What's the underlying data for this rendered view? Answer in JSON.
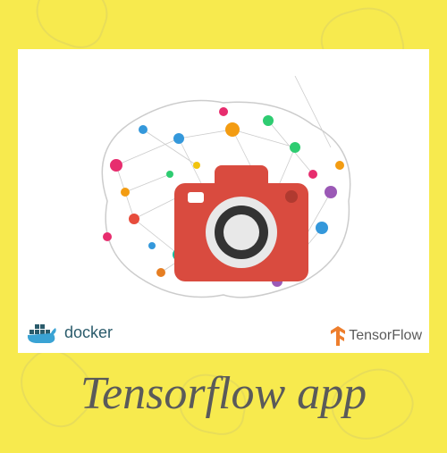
{
  "title": "Tensorflow app",
  "logos": {
    "docker": {
      "text": "docker"
    },
    "tensorflow": {
      "text_tensor": "Tensor",
      "text_flow": "Flow"
    }
  },
  "colors": {
    "background": "#f7ea4e",
    "camera": "#d94b3f",
    "title_color": "#5a5a5a"
  }
}
